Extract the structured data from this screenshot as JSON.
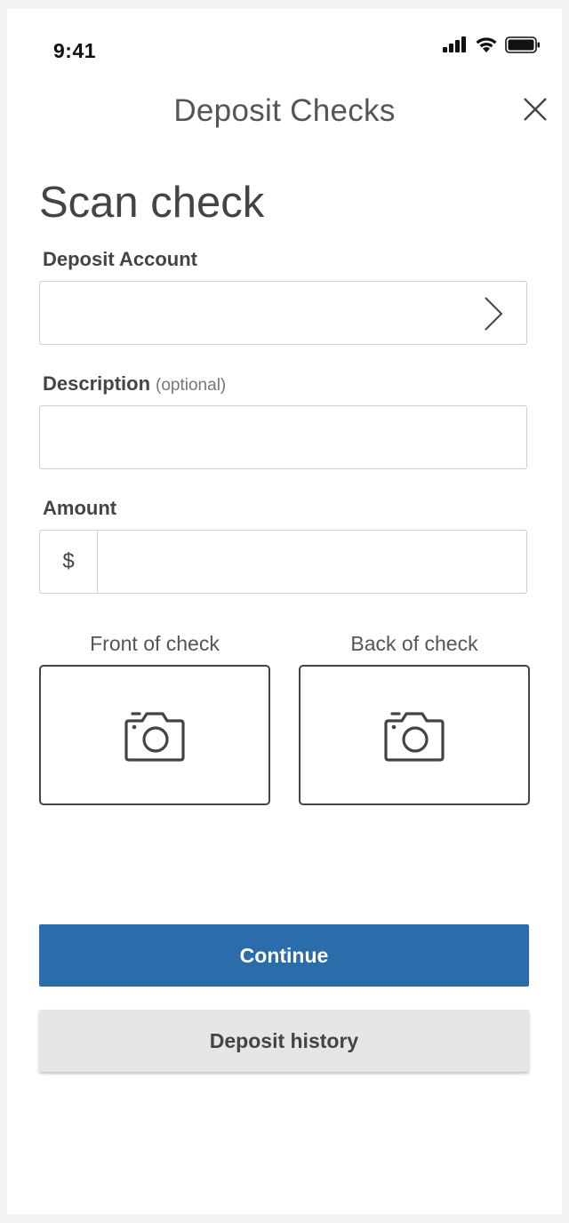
{
  "status_bar": {
    "time": "9:41",
    "icons": [
      "cellular-signal-icon",
      "wifi-icon",
      "battery-icon"
    ]
  },
  "header": {
    "title": "Deposit Checks",
    "close_icon": "close-icon"
  },
  "page": {
    "title": "Scan check"
  },
  "form": {
    "deposit_account": {
      "label": "Deposit Account",
      "value": "",
      "icon": "chevron-right-icon"
    },
    "description": {
      "label": "Description",
      "optional_hint": "(optional)",
      "value": ""
    },
    "amount": {
      "label": "Amount",
      "currency_symbol": "$",
      "value": ""
    }
  },
  "capture": {
    "front_label": "Front of check",
    "back_label": "Back of check",
    "icon": "camera-icon"
  },
  "actions": {
    "continue_label": "Continue",
    "history_label": "Deposit history"
  },
  "colors": {
    "primary": "#2b6dab",
    "secondary_bg": "#e6e6e6",
    "text": "#444444",
    "border": "#cfcfcf"
  }
}
